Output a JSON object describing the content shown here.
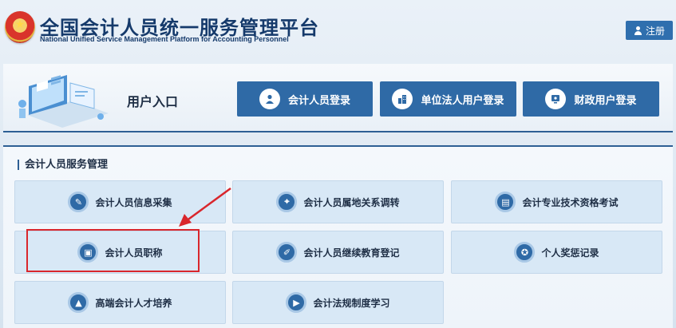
{
  "header": {
    "title_cn": "全国会计人员统一服务管理平台",
    "title_en": "National Unified Service Management Platform for Accounting Personnel",
    "register_label": "注册"
  },
  "login_panel": {
    "title": "用户入口",
    "buttons": [
      {
        "label": "会计人员登录",
        "icon": "user-icon"
      },
      {
        "label": "单位法人用户登录",
        "icon": "building-icon"
      },
      {
        "label": "财政用户登录",
        "icon": "monitor-icon"
      }
    ]
  },
  "services": {
    "section_title": "会计人员服务管理",
    "tiles": [
      {
        "label": "会计人员信息采集",
        "icon": "edit-form-icon"
      },
      {
        "label": "会计人员属地关系调转",
        "icon": "location-transfer-icon"
      },
      {
        "label": "会计专业技术资格考试",
        "icon": "printer-icon"
      },
      {
        "label": "会计人员职称",
        "icon": "title-certificate-icon"
      },
      {
        "label": "会计人员继续教育登记",
        "icon": "education-record-icon"
      },
      {
        "label": "个人奖惩记录",
        "icon": "award-record-icon"
      },
      {
        "label": "高端会计人才培养",
        "icon": "graduation-cap-icon"
      },
      {
        "label": "会计法规制度学习",
        "icon": "video-play-icon"
      }
    ]
  },
  "annotation": {
    "highlighted_tile": "会计人员职称",
    "color": "#d9262c"
  },
  "colors": {
    "brand_blue": "#2f6aa6",
    "title_navy": "#153a6b",
    "tile_bg": "#d8e8f6"
  }
}
